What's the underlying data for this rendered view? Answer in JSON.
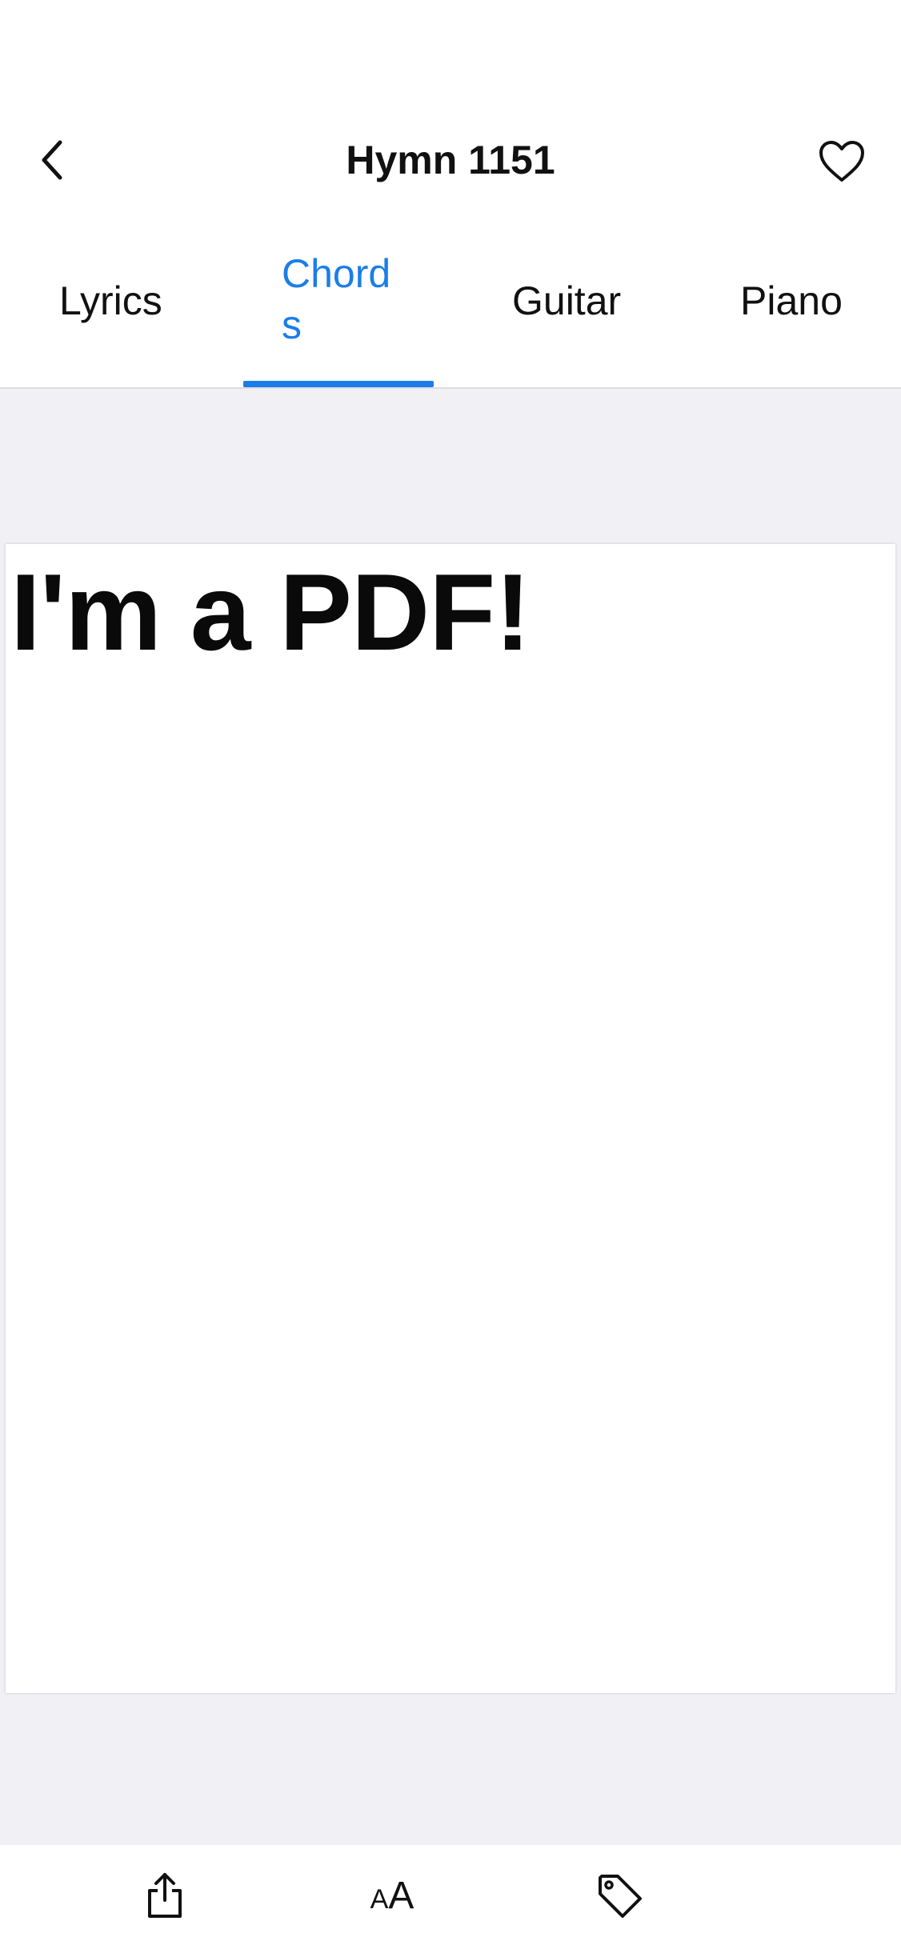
{
  "nav": {
    "title": "Hymn 1151"
  },
  "tabs": [
    {
      "label": "Lyrics",
      "active": false
    },
    {
      "label": "Chord\ns",
      "active": true
    },
    {
      "label": "Guitar",
      "active": false
    },
    {
      "label": "Piano",
      "active": false
    }
  ],
  "document": {
    "text": "I'm a PDF!"
  },
  "toolbar": {
    "share_icon": "share-icon",
    "text_size_icon": "text-size-icon",
    "tag_icon": "tag-icon"
  },
  "colors": {
    "accent": "#1a7ee8",
    "content_background": "#f0f0f5",
    "text": "#111111"
  }
}
